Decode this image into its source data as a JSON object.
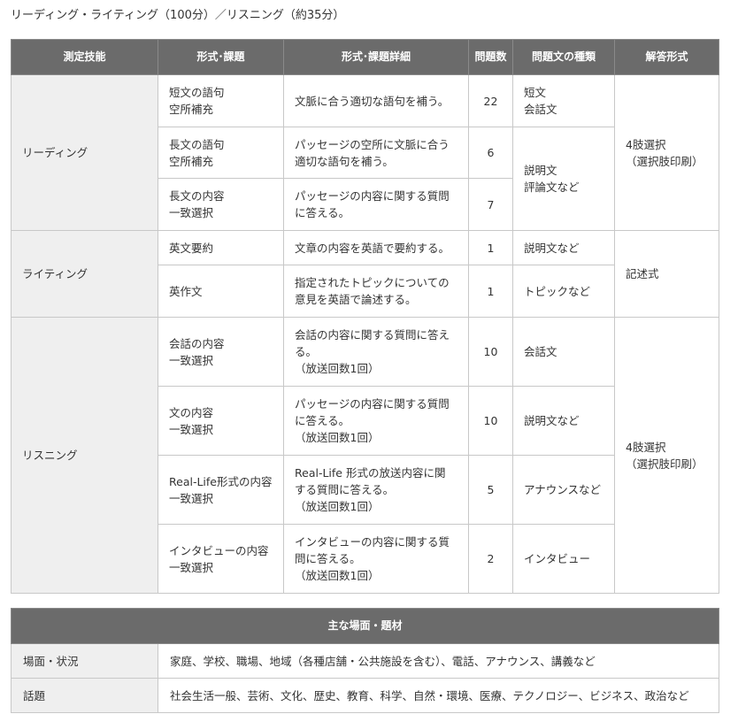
{
  "heading": "リーディング・ライティング（100分）／リスニング（約35分）",
  "main_table": {
    "headers": [
      "測定技能",
      "形式･課題",
      "形式･課題詳細",
      "問題数",
      "問題文の種類",
      "解答形式"
    ],
    "reading": {
      "skill": "リーディング",
      "answer_format": [
        "4肢選択",
        "（選択肢印刷）"
      ],
      "rows": [
        {
          "format": [
            "短文の語句",
            "空所補充"
          ],
          "detail": [
            "文脈に合う適切な語句を補う。"
          ],
          "count": "22",
          "type": [
            "短文",
            "会話文"
          ]
        },
        {
          "format": [
            "長文の語句",
            "空所補充"
          ],
          "detail": [
            "パッセージの空所に文脈に合う",
            "適切な語句を補う。"
          ],
          "count": "6"
        },
        {
          "format": [
            "長文の内容",
            "一致選択"
          ],
          "detail": [
            "パッセージの内容に関する質問",
            "に答える。"
          ],
          "count": "7"
        }
      ],
      "shared_type": [
        "説明文",
        "評論文など"
      ]
    },
    "writing": {
      "skill": "ライティング",
      "answer_format": [
        "記述式"
      ],
      "rows": [
        {
          "format": [
            "英文要約"
          ],
          "detail": [
            "文章の内容を英語で要約する。"
          ],
          "count": "1",
          "type": [
            "説明文など"
          ]
        },
        {
          "format": [
            "英作文"
          ],
          "detail": [
            "指定されたトピックについての",
            "意見を英語で論述する。"
          ],
          "count": "1",
          "type": [
            "トピックなど"
          ]
        }
      ]
    },
    "listening": {
      "skill": "リスニング",
      "answer_format": [
        "4肢選択",
        "（選択肢印刷）"
      ],
      "rows": [
        {
          "format": [
            "会話の内容",
            "一致選択"
          ],
          "detail": [
            "会話の内容に関する質問に答え",
            "る。",
            "（放送回数1回）"
          ],
          "count": "10",
          "type": [
            "会話文"
          ]
        },
        {
          "format": [
            "文の内容",
            "一致選択"
          ],
          "detail": [
            "パッセージの内容に関する質問",
            "に答える。",
            "（放送回数1回）"
          ],
          "count": "10",
          "type": [
            "説明文など"
          ]
        },
        {
          "format": [
            "Real-Life形式の内容",
            "一致選択"
          ],
          "detail": [
            "Real-Life 形式の放送内容に関",
            "する質問に答える。",
            "（放送回数1回）"
          ],
          "count": "5",
          "type": [
            "アナウンスなど"
          ]
        },
        {
          "format": [
            "インタビューの内容",
            "一致選択"
          ],
          "detail": [
            "インタビューの内容に関する質",
            "問に答える。",
            "（放送回数1回）"
          ],
          "count": "2",
          "type": [
            "インタビュー"
          ]
        }
      ]
    }
  },
  "theme_table": {
    "header": "主な場面・題材",
    "rows": [
      {
        "label": "場面・状況",
        "value": "家庭、学校、職場、地域（各種店舗・公共施設を含む）、電話、アナウンス、講義など"
      },
      {
        "label": "話題",
        "value": "社会生活一般、芸術、文化、歴史、教育、科学、自然・環境、医療、テクノロジー、ビジネス、政治など"
      }
    ]
  }
}
